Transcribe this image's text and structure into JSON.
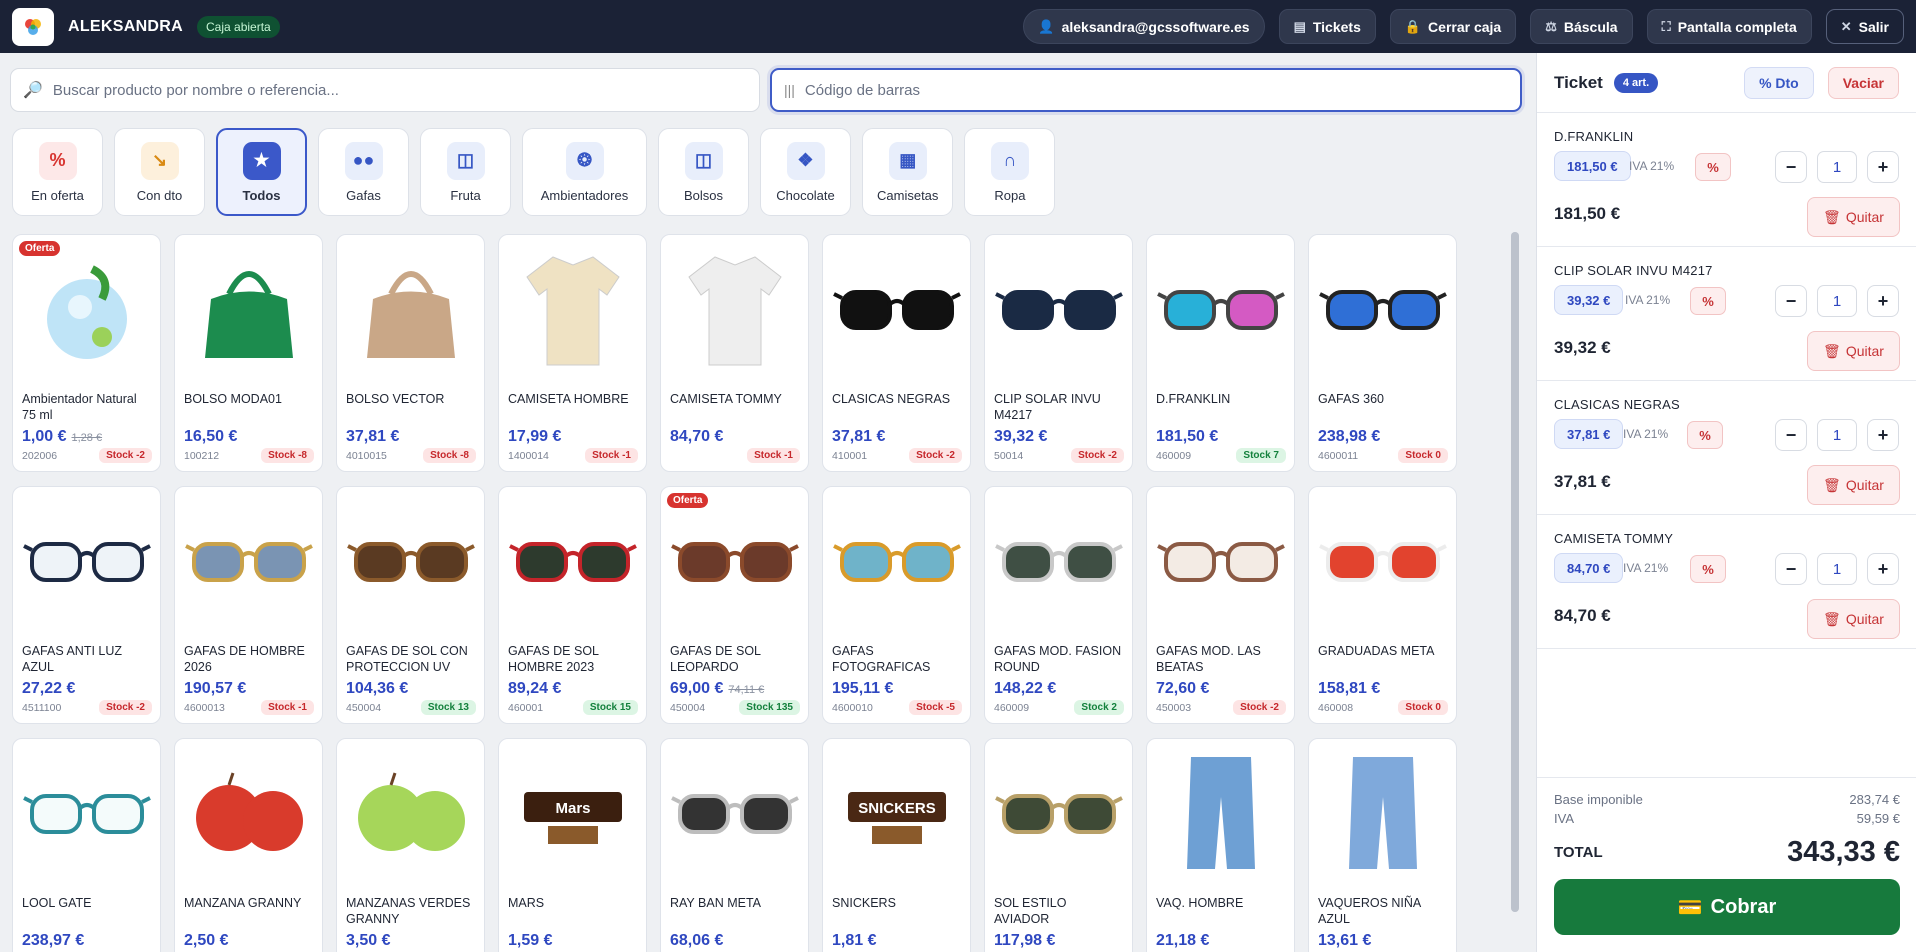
{
  "topbar": {
    "user_name": "ALEKSANDRA",
    "status": "Caja abierta",
    "email": "aleksandra@gcssoftware.es",
    "tickets": "Tickets",
    "close_register": "Cerrar caja",
    "scale": "Báscula",
    "fullscreen": "Pantalla completa",
    "exit": "Salir"
  },
  "search": {
    "product_placeholder": "Buscar producto por nombre o referencia...",
    "barcode_placeholder": "Código de barras"
  },
  "categories": [
    {
      "label": "En oferta",
      "icon": "percent-icon"
    },
    {
      "label": "Con dto",
      "icon": "arrow-down-right-icon"
    },
    {
      "label": "Todos",
      "icon": "star-icon"
    },
    {
      "label": "Gafas",
      "icon": "glasses-icon"
    },
    {
      "label": "Fruta",
      "icon": "basket-icon"
    },
    {
      "label": "Ambientadores",
      "icon": "wheel-icon"
    },
    {
      "label": "Bolsos",
      "icon": "bag-icon"
    },
    {
      "label": "Chocolate",
      "icon": "cubes-icon"
    },
    {
      "label": "Camisetas",
      "icon": "shirt-icon"
    },
    {
      "label": "Ropa",
      "icon": "pants-icon"
    }
  ],
  "products": [
    {
      "name": "Ambientador Natural 75 ml",
      "price": "1,00 €",
      "old_price": "1,28 €",
      "ref": "202006",
      "stock": "Stock -2",
      "oferta": "Oferta"
    },
    {
      "name": "BOLSO MODA01",
      "price": "16,50 €",
      "ref": "100212",
      "stock": "Stock -8"
    },
    {
      "name": "BOLSO VECTOR",
      "price": "37,81 €",
      "ref": "4010015",
      "stock": "Stock -8"
    },
    {
      "name": "CAMISETA HOMBRE",
      "price": "17,99 €",
      "ref": "1400014",
      "stock": "Stock -1"
    },
    {
      "name": "CAMISETA TOMMY",
      "price": "84,70 €",
      "ref": "",
      "stock": "Stock -1"
    },
    {
      "name": "CLASICAS NEGRAS",
      "price": "37,81 €",
      "ref": "410001",
      "stock": "Stock -2"
    },
    {
      "name": "CLIP SOLAR INVU M4217",
      "price": "39,32 €",
      "ref": "50014",
      "stock": "Stock -2"
    },
    {
      "name": "D.FRANKLIN",
      "price": "181,50 €",
      "ref": "460009",
      "stock": "Stock 7"
    },
    {
      "name": "GAFAS 360",
      "price": "238,98 €",
      "ref": "4600011",
      "stock": "Stock 0"
    },
    {
      "name": "GAFAS ANTI LUZ AZUL",
      "price": "27,22 €",
      "ref": "4511100",
      "stock": "Stock -2"
    },
    {
      "name": "GAFAS DE HOMBRE 2026",
      "price": "190,57 €",
      "ref": "4600013",
      "stock": "Stock -1"
    },
    {
      "name": "GAFAS DE SOL CON PROTECCION UV",
      "price": "104,36 €",
      "ref": "450004",
      "stock": "Stock 13"
    },
    {
      "name": "GAFAS DE SOL HOMBRE 2023",
      "price": "89,24 €",
      "ref": "460001",
      "stock": "Stock 15"
    },
    {
      "name": "GAFAS DE SOL LEOPARDO",
      "price": "69,00 €",
      "old_price": "74,11 €",
      "ref": "450004",
      "stock": "Stock 135",
      "oferta": "Oferta"
    },
    {
      "name": "GAFAS FOTOGRAFICAS",
      "price": "195,11 €",
      "ref": "4600010",
      "stock": "Stock -5"
    },
    {
      "name": "GAFAS MOD. FASION ROUND",
      "price": "148,22 €",
      "ref": "460009",
      "stock": "Stock 2"
    },
    {
      "name": "GAFAS MOD. LAS BEATAS",
      "price": "72,60 €",
      "ref": "450003",
      "stock": "Stock -2"
    },
    {
      "name": "GRADUADAS META",
      "price": "158,81 €",
      "ref": "460008",
      "stock": "Stock 0"
    },
    {
      "name": "LOOL GATE",
      "price": "238,97 €",
      "ref": "",
      "stock": ""
    },
    {
      "name": "MANZANA GRANNY",
      "price": "2,50 €",
      "ref": "",
      "stock": ""
    },
    {
      "name": "MANZANAS VERDES GRANNY",
      "price": "3,50 €",
      "ref": "",
      "stock": ""
    },
    {
      "name": "MARS",
      "price": "1,59 €",
      "ref": "",
      "stock": ""
    },
    {
      "name": "RAY BAN META",
      "price": "68,06 €",
      "ref": "",
      "stock": ""
    },
    {
      "name": "SNICKERS",
      "price": "1,81 €",
      "ref": "",
      "stock": ""
    },
    {
      "name": "SOL ESTILO AVIADOR",
      "price": "117,98 €",
      "ref": "",
      "stock": ""
    },
    {
      "name": "VAQ. HOMBRE",
      "price": "21,18 €",
      "ref": "",
      "stock": ""
    },
    {
      "name": "VAQUEROS NIÑA AZUL",
      "price": "13,61 €",
      "ref": "",
      "stock": ""
    }
  ],
  "ticket": {
    "title": "Ticket",
    "count": "4 art.",
    "discount_button": "% Dto",
    "empty_button": "Vaciar",
    "iva_label": "IVA 21%",
    "pct_label": "%",
    "remove_label": "Quitar",
    "lines": [
      {
        "name": "D.FRANKLIN",
        "unit_price": "181,50 €",
        "qty": "1",
        "total": "181,50 €"
      },
      {
        "name": "CLIP SOLAR INVU M4217",
        "unit_price": "39,32 €",
        "qty": "1",
        "total": "39,32 €"
      },
      {
        "name": "CLASICAS NEGRAS",
        "unit_price": "37,81 €",
        "qty": "1",
        "total": "37,81 €"
      },
      {
        "name": "CAMISETA TOMMY",
        "unit_price": "84,70 €",
        "qty": "1",
        "total": "84,70 €"
      }
    ],
    "base_label": "Base imponible",
    "base_value": "283,74 €",
    "iva_total_label": "IVA",
    "iva_value": "59,59 €",
    "total_label": "TOTAL",
    "total_value": "343,33 €",
    "pay_button": "Cobrar"
  },
  "colors": {
    "accent": "#3656c4",
    "topbar": "#1b2236",
    "pay": "#177a3d",
    "danger": "#c63436"
  }
}
